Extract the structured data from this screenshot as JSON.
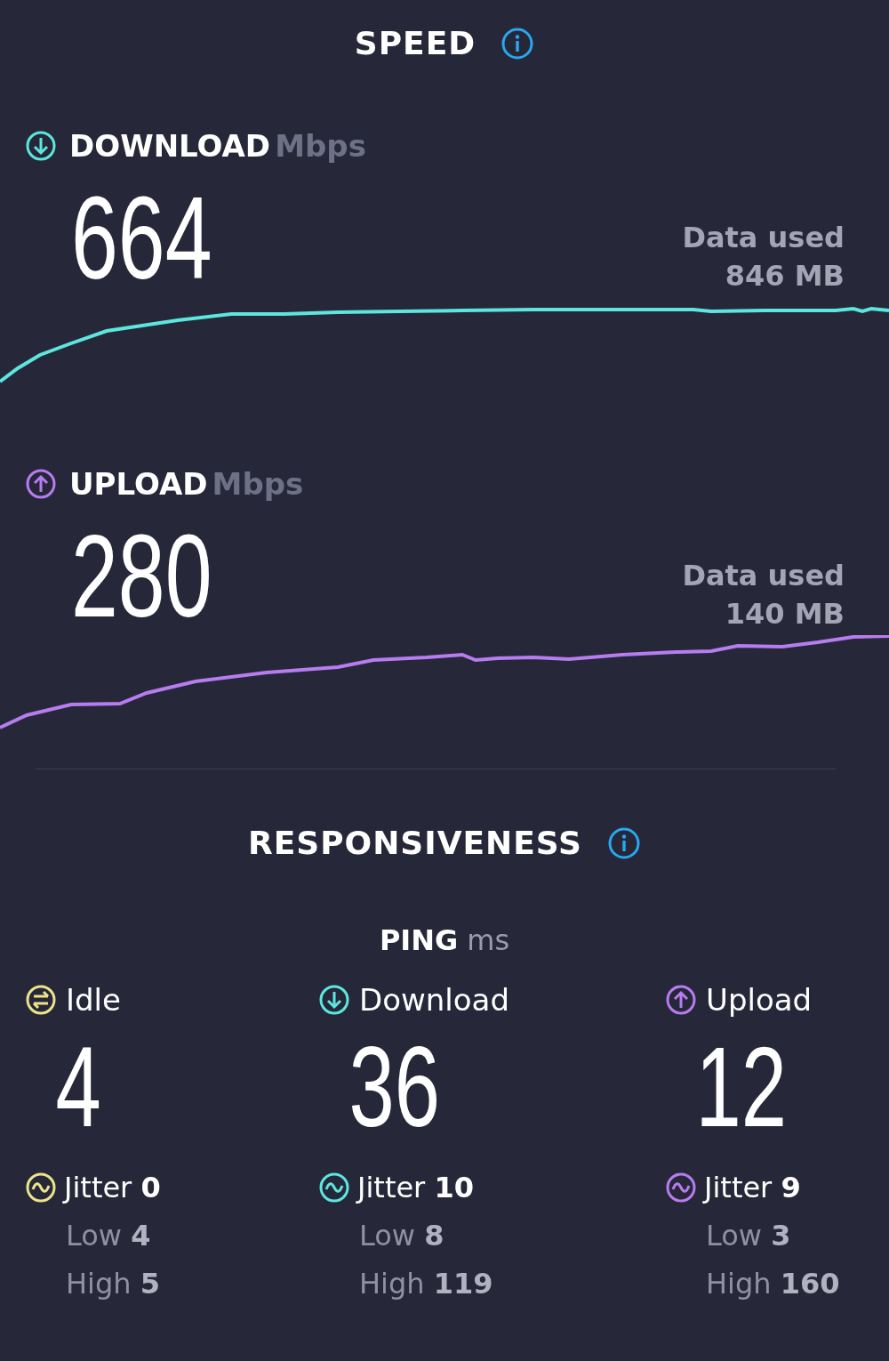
{
  "speed": {
    "title": "SPEED",
    "metrics": [
      {
        "kind": "download",
        "label": "DOWNLOAD",
        "unit": "Mbps",
        "value": "664",
        "data_used_label": "Data used",
        "data_used": "846 MB"
      },
      {
        "kind": "upload",
        "label": "UPLOAD",
        "unit": "Mbps",
        "value": "280",
        "data_used_label": "Data used",
        "data_used": "140 MB"
      }
    ]
  },
  "responsiveness": {
    "title": "RESPONSIVENESS",
    "ping": {
      "label": "PING",
      "unit": "ms"
    },
    "columns": [
      {
        "kind": "idle",
        "label": "Idle",
        "value": "4",
        "jitter_label": "Jitter",
        "jitter": "0",
        "low_label": "Low",
        "low": "4",
        "high_label": "High",
        "high": "5"
      },
      {
        "kind": "download",
        "label": "Download",
        "value": "36",
        "jitter_label": "Jitter",
        "jitter": "10",
        "low_label": "Low",
        "low": "8",
        "high_label": "High",
        "high": "119"
      },
      {
        "kind": "upload",
        "label": "Upload",
        "value": "12",
        "jitter_label": "Jitter",
        "jitter": "9",
        "low_label": "Low",
        "low": "3",
        "high_label": "High",
        "high": "160"
      }
    ]
  }
}
